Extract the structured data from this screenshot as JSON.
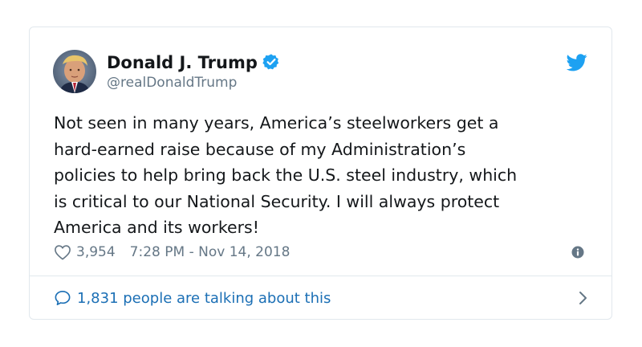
{
  "tweet": {
    "author": {
      "name": "Donald J. Trump",
      "handle": "@realDonaldTrump",
      "verified": true
    },
    "text": "Not seen in many years, America’s steelworkers get a\nhard-earned raise because of my Administration’s\npolicies to help bring back the U.S. steel industry, which\nis critical to our National Security. I will always protect\nAmerica and its workers!",
    "likes": "3,954",
    "timestamp": "7:28 PM - Nov 14, 2018",
    "conversation_label": "1,831 people are talking about this"
  },
  "icons": {
    "brand": "twitter-bird-icon",
    "verified": "verified-badge-icon",
    "like": "heart-icon",
    "info": "info-icon",
    "conversation": "speech-bubble-icon",
    "chevron": "chevron-right-icon"
  },
  "colors": {
    "twitter_blue": "#1da1f2",
    "link_blue": "#1b6fb5",
    "text_primary": "#14171a",
    "text_secondary": "#657786",
    "border": "#e1e8ed"
  }
}
